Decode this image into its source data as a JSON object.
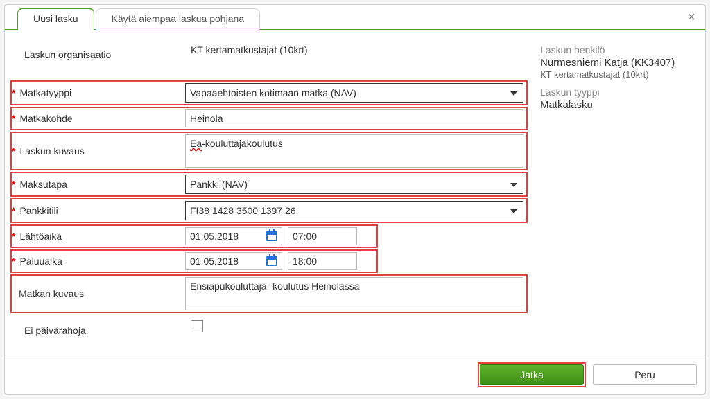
{
  "tabs": {
    "new_invoice": "Uusi lasku",
    "use_previous": "Käytä aiempaa laskua pohjana"
  },
  "labels": {
    "org": "Laskun organisaatio",
    "trip_type": "Matkatyyppi",
    "destination": "Matkakohde",
    "description": "Laskun kuvaus",
    "payment": "Maksutapa",
    "bank": "Pankkitili",
    "departure": "Lähtöaika",
    "return": "Paluuaika",
    "trip_desc": "Matkan kuvaus",
    "no_allowance": "Ei päivärahoja"
  },
  "values": {
    "org": "KT kertamatkustajat (10krt)",
    "trip_type": "Vapaaehtoisten kotimaan matka (NAV)",
    "destination": "Heinola",
    "description_prefix": "Ea",
    "description_rest": "-kouluttajakoulutus",
    "payment": "Pankki (NAV)",
    "bank": "FI38 1428 3500 1397 26",
    "dep_date": "01.05.2018",
    "dep_time": "07:00",
    "ret_date": "01.05.2018",
    "ret_time": "18:00",
    "trip_desc": "Ensiapukouluttaja -koulutus Heinolassa"
  },
  "side": {
    "person_label": "Laskun henkilö",
    "person_value": "Nurmesniemi Katja (KK3407)",
    "person_sub": "KT kertamatkustajat (10krt)",
    "type_label": "Laskun tyyppi",
    "type_value": "Matkalasku"
  },
  "buttons": {
    "continue": "Jatka",
    "cancel": "Peru"
  }
}
